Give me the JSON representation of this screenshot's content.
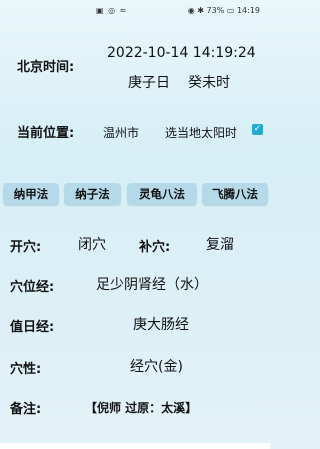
{
  "status_bar": {
    "left_icons": "▣ ◎ ≈",
    "right": "◉ ✱ 73% ▭ 14:19"
  },
  "time": {
    "label": "北京时间:",
    "datetime": "2022-10-14 14:19:24",
    "day_ganzhi": "庚子日",
    "hour_ganzhi": "癸未时"
  },
  "location": {
    "label": "当前位置:",
    "city": "温州市",
    "solar_time_option": "选当地太阳时",
    "solar_time_checked": true
  },
  "methods": [
    "纳甲法",
    "纳子法",
    "灵龟八法",
    "飞腾八法"
  ],
  "details": {
    "kaixue_label": "开穴:",
    "kaixue_value": "闭穴",
    "buxue_label": "补穴:",
    "buxue_value": "复溜",
    "meridian_label": "穴位经:",
    "meridian_value": "足少阴肾经（水）",
    "duty_label": "值日经:",
    "duty_value": "庚大肠经",
    "nature_label": "穴性:",
    "nature_value": "经穴(金)",
    "note_label": "备注:",
    "note_value": "【倪师 过原：太溪】"
  }
}
